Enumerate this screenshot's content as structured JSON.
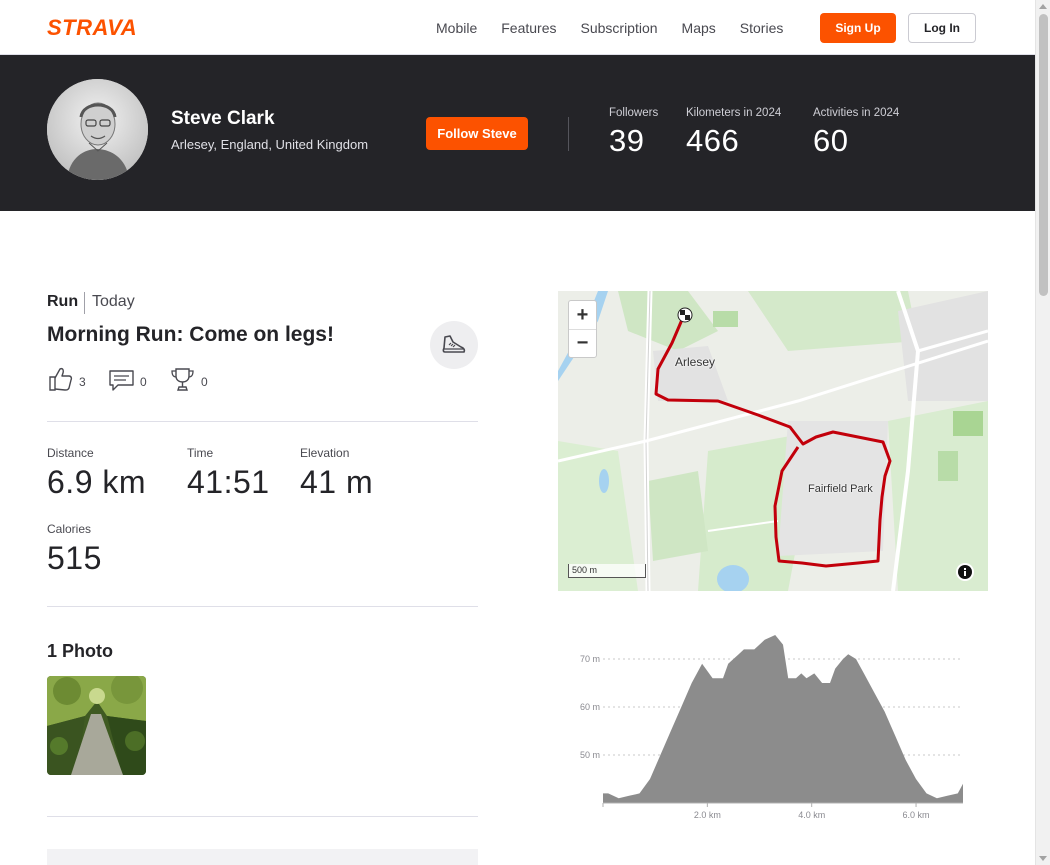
{
  "nav": {
    "brand": "STRAVA",
    "links": [
      "Mobile",
      "Features",
      "Subscription",
      "Maps",
      "Stories"
    ],
    "signup_label": "Sign Up",
    "login_label": "Log In",
    "brand_color": "#fc5200"
  },
  "athlete": {
    "name": "Steve Clark",
    "location": "Arlesey, England, United Kingdom",
    "follow_label": "Follow Steve",
    "stats": [
      {
        "label": "Followers",
        "value": "39"
      },
      {
        "label": "Kilometers in 2024",
        "value": "466"
      },
      {
        "label": "Activities in 2024",
        "value": "60"
      }
    ]
  },
  "activity": {
    "type": "Run",
    "date": "Today",
    "title": "Morning Run: Come on legs!",
    "sport_icon": "shoe-icon",
    "kudos": "3",
    "comments": "0",
    "achievements": "0",
    "metrics": {
      "distance": {
        "label": "Distance",
        "value": "6.9 km"
      },
      "time": {
        "label": "Time",
        "value": "41:51"
      },
      "elevation": {
        "label": "Elevation",
        "value": "41 m"
      },
      "calories": {
        "label": "Calories",
        "value": "515"
      }
    },
    "photos_title": "1 Photo"
  },
  "map": {
    "zoom_in": "+",
    "zoom_out": "−",
    "labels": {
      "town": "Arlesey",
      "area": "Fairfield Park"
    },
    "scale": "500 m",
    "route_color": "#c2000b"
  },
  "chart_data": {
    "type": "area",
    "title": "",
    "xlabel": "",
    "ylabel": "",
    "y_ticks": [
      "70 m",
      "60 m",
      "50 m"
    ],
    "y_tick_values": [
      70,
      60,
      50
    ],
    "x_ticks": [
      "2.0 km",
      "4.0 km",
      "6.0 km"
    ],
    "x_tick_values": [
      2.0,
      4.0,
      6.0
    ],
    "ylim": [
      40,
      75
    ],
    "xlim": [
      0,
      6.9
    ],
    "x": [
      0,
      0.1,
      0.3,
      0.5,
      0.7,
      0.9,
      1.1,
      1.3,
      1.5,
      1.7,
      1.9,
      2.1,
      2.3,
      2.4,
      2.5,
      2.6,
      2.7,
      2.9,
      3.1,
      3.3,
      3.45,
      3.55,
      3.7,
      3.8,
      3.9,
      4.05,
      4.2,
      4.35,
      4.45,
      4.6,
      4.7,
      4.85,
      5.0,
      5.2,
      5.4,
      5.6,
      5.8,
      6.0,
      6.2,
      6.4,
      6.6,
      6.8,
      6.9
    ],
    "y": [
      42,
      42,
      41,
      41.5,
      42,
      45,
      50,
      55,
      60,
      65,
      69,
      66,
      66,
      69,
      70,
      71,
      72,
      72,
      74,
      75,
      73,
      66,
      66,
      67,
      66,
      67,
      65,
      65,
      68,
      70,
      71,
      70,
      67,
      63,
      59,
      54,
      49,
      45,
      42,
      41,
      41.5,
      42,
      44
    ],
    "color": "#8c8c8c"
  }
}
